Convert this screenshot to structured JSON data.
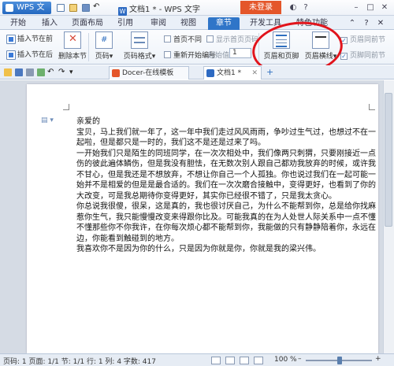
{
  "titlebar": {
    "app_menu": "WPS 文字",
    "doc_title": "文档1 * - WPS 文字",
    "login": "未登录"
  },
  "ribbon_tabs": [
    "开始",
    "插入",
    "页面布局",
    "引用",
    "审阅",
    "视图",
    "章节",
    "开发工具",
    "特色功能"
  ],
  "ribbon_active_tab": "章节",
  "ribbon": {
    "insert_section_before": "插入节在前",
    "insert_section_after": "插入节在后",
    "delete_section": "删除本节",
    "page_number": "页码",
    "page_number_format": "页码格式",
    "first_page_diff": "首页不同",
    "show_first_page_number": "显示首页页码",
    "renumber": "重新开始编号",
    "start_value_label": "起始值:",
    "start_value": "1",
    "header_footer": "页眉和页脚",
    "header_line": "页眉横线",
    "header_same_prev": "页眉同前节",
    "footer_same_prev": "页脚同前节"
  },
  "doc_tabs": [
    "Docer-在线模板",
    "文档1 *"
  ],
  "document": {
    "paragraphs": [
      "亲爱的",
      "宝贝，马上我们就一年了，这一年中我们走过风风雨雨，争吵过生气过，也想过不在一",
      "起啦，但是都只是一时的，我们这不是还是过来了吗。",
      "一开始我们只是陌生的同班同学，在一次次相处中，我们像两只刺猬，只要刚接近一点就",
      "伤的彼此遍体鳞伤，但是我没有胆怯，在无数次别人跟自己都劝我放弃的时候，或许我是",
      "不甘心，但是我还是不想放弃，不想让你自己一个人孤独。你也说过我们在一起可能一开",
      "始并不是相爱的但是是最合适的。我们在一次次磨合接触中，变得更好，也看到了你的巨",
      "大改变，可是我总期待你变得更好，其实你已经很不错了，只是我太贪心。",
      "你总说我很傻，很呆，这是真的，我也很讨厌自己，为什么不能帮到你，总是给你找麻烦",
      "惹你生气，我只能慢慢改变来得跟你比及。可能我真的在为人处世人际关系中一点不懂，",
      "不懂那些你不你我许，在你每次烦心都不能帮到你，我能做的只有静静陪着你，永远在你身",
      "边，你能看到触碰到的地方。",
      "我喜欢你不是因为你的什么，只是因为你就是你，你就是我的梁兴伟。"
    ]
  },
  "statusbar": {
    "text": "页码: 1   页面: 1/1   节: 1/1   行: 1   列: 4   字数: 417",
    "zoom": "100 %"
  },
  "colors": {
    "accent": "#2f75c8",
    "login": "#e4562a",
    "annotation": "#e1141c"
  }
}
